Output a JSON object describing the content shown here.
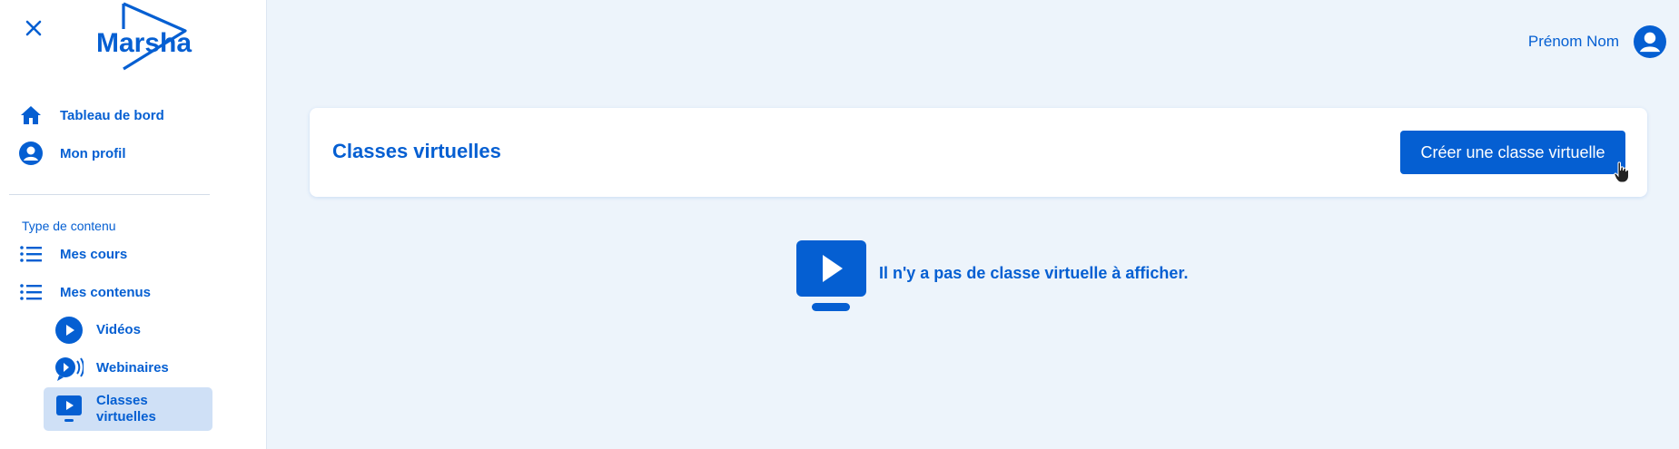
{
  "sidebar": {
    "logo_text": "Marsha",
    "items": [
      {
        "label": "Tableau de bord",
        "icon": "home-icon"
      },
      {
        "label": "Mon profil",
        "icon": "user-circle-icon"
      }
    ],
    "section_title": "Type de contenu",
    "content_items": [
      {
        "label": "Mes cours",
        "icon": "list-icon"
      },
      {
        "label": "Mes contenus",
        "icon": "list-icon"
      }
    ],
    "sub_items": [
      {
        "label": "Vidéos",
        "icon": "play-circle-icon"
      },
      {
        "label": "Webinaires",
        "icon": "broadcast-icon"
      },
      {
        "label": "Classes virtuelles",
        "icon": "screen-play-icon",
        "active": true
      }
    ]
  },
  "header": {
    "user_name": "Prénom Nom"
  },
  "main": {
    "title": "Classes virtuelles",
    "create_button": "Créer une classe virtuelle",
    "empty_message": "Il n'y a pas de classe virtuelle à afficher."
  },
  "colors": {
    "primary": "#055fd2",
    "background": "#edf4fb",
    "active_item": "#cfe0f6"
  }
}
